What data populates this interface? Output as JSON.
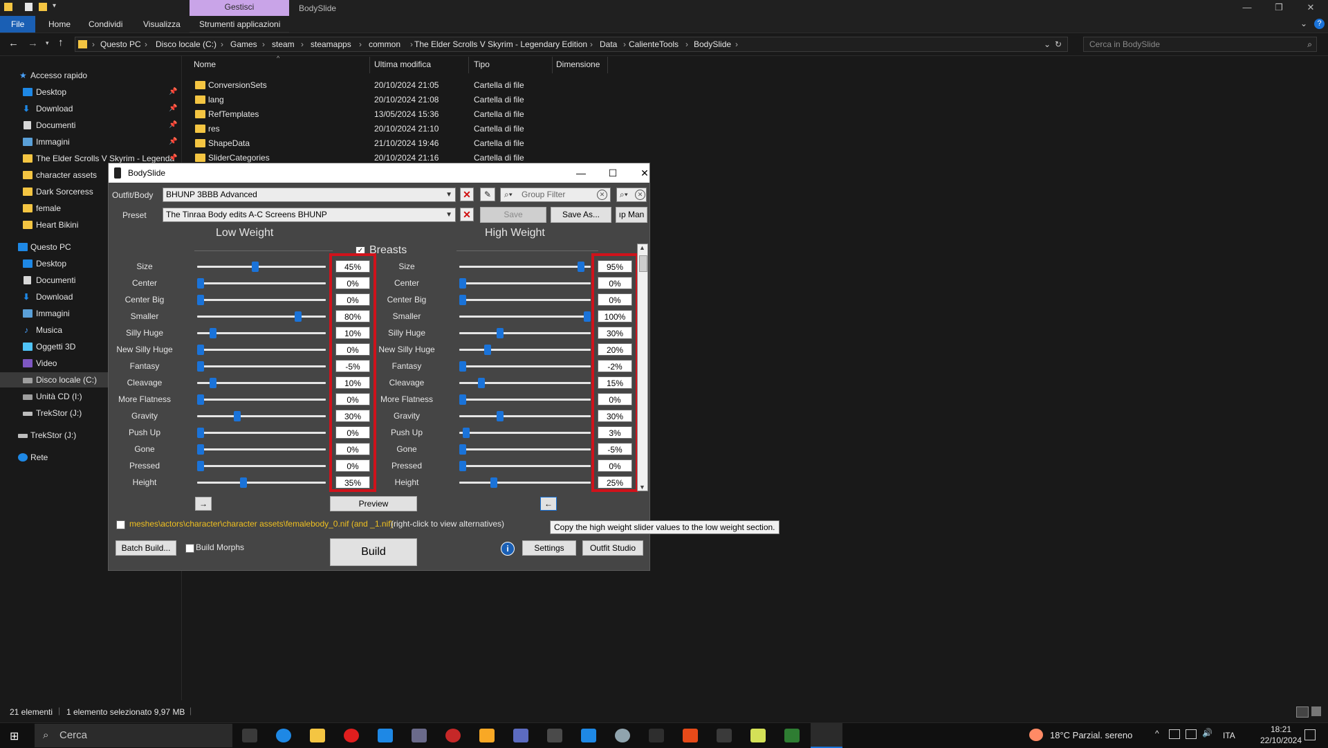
{
  "explorer": {
    "title_context_tab": "Gestisci",
    "title_window": "BodySlide",
    "ribbon_tabs": [
      "File",
      "Home",
      "Condividi",
      "Visualizza",
      "Strumenti applicazioni"
    ],
    "breadcrumb": [
      "Questo PC",
      "Disco locale (C:)",
      "Games",
      "steam",
      "steamapps",
      "common",
      "The Elder Scrolls V Skyrim - Legendary Edition",
      "Data",
      "CalienteTools",
      "BodySlide"
    ],
    "search_placeholder": "Cerca in BodySlide",
    "nav": {
      "quick_access": "Accesso rapido",
      "quick_items": [
        "Desktop",
        "Download",
        "Documenti",
        "Immagini",
        "The Elder Scrolls V Skyrim - Legenda",
        "character assets",
        "Dark Sorceress",
        "female",
        "Heart Bikini"
      ],
      "this_pc": "Questo PC",
      "pc_items": [
        "Desktop",
        "Documenti",
        "Download",
        "Immagini",
        "Musica",
        "Oggetti 3D",
        "Video",
        "Disco locale (C:)",
        "Unità CD (I:)",
        "TrekStor (J:)"
      ],
      "trekstor": "TrekStor (J:)",
      "network": "Rete"
    },
    "columns": [
      "Nome",
      "Ultima modifica",
      "Tipo",
      "Dimensione"
    ],
    "files": [
      {
        "name": "ConversionSets",
        "date": "20/10/2024 21:05",
        "type": "Cartella di file"
      },
      {
        "name": "lang",
        "date": "20/10/2024 21:08",
        "type": "Cartella di file"
      },
      {
        "name": "RefTemplates",
        "date": "13/05/2024 15:36",
        "type": "Cartella di file"
      },
      {
        "name": "res",
        "date": "20/10/2024 21:10",
        "type": "Cartella di file"
      },
      {
        "name": "ShapeData",
        "date": "21/10/2024 19:46",
        "type": "Cartella di file"
      },
      {
        "name": "SliderCategories",
        "date": "20/10/2024 21:16",
        "type": "Cartella di file"
      }
    ],
    "status": {
      "count": "21 elementi",
      "selected": "1 elemento selezionato  9,97 MB"
    }
  },
  "bodyslide": {
    "title": "BodySlide",
    "outfit_label": "Outfit/Body",
    "outfit_value": "BHUNP 3BBB Advanced",
    "group_filter_placeholder": "Group Filter",
    "preset_label": "Preset",
    "preset_value": "The Tinraa Body edits A-C Screens BHUNP",
    "save": "Save",
    "save_as": "Save As...",
    "group_manager": "ıp Man",
    "low_weight": "Low Weight",
    "high_weight": "High Weight",
    "category": "Breasts",
    "sliders": [
      {
        "name": "Size",
        "low": "45%",
        "high": "95%",
        "lowv": 45,
        "highv": 95
      },
      {
        "name": "Center",
        "low": "0%",
        "high": "0%",
        "lowv": 0,
        "highv": 0
      },
      {
        "name": "Center Big",
        "low": "0%",
        "high": "0%",
        "lowv": 0,
        "highv": 0
      },
      {
        "name": "Smaller",
        "low": "80%",
        "high": "100%",
        "lowv": 80,
        "highv": 100
      },
      {
        "name": "Silly Huge",
        "low": "10%",
        "high": "30%",
        "lowv": 10,
        "highv": 30
      },
      {
        "name": "New Silly Huge",
        "low": "0%",
        "high": "20%",
        "lowv": 0,
        "highv": 20
      },
      {
        "name": "Fantasy",
        "low": "-5%",
        "high": "-2%",
        "lowv": -5,
        "highv": -2
      },
      {
        "name": "Cleavage",
        "low": "10%",
        "high": "15%",
        "lowv": 10,
        "highv": 15
      },
      {
        "name": "More Flatness",
        "low": "0%",
        "high": "0%",
        "lowv": 0,
        "highv": 0
      },
      {
        "name": "Gravity",
        "low": "30%",
        "high": "30%",
        "lowv": 30,
        "highv": 30
      },
      {
        "name": "Push Up",
        "low": "0%",
        "high": "3%",
        "lowv": 0,
        "highv": 3
      },
      {
        "name": "Gone",
        "low": "0%",
        "high": "-5%",
        "lowv": 0,
        "highv": -5
      },
      {
        "name": "Pressed",
        "low": "0%",
        "high": "0%",
        "lowv": 0,
        "highv": 0
      },
      {
        "name": "Height",
        "low": "35%",
        "high": "25%",
        "lowv": 35,
        "highv": 25
      }
    ],
    "copy_right": "→",
    "copy_left": "←",
    "preview": "Preview",
    "path": "meshes\\actors\\character\\character assets\\femalebody_0.nif (and _1.nif)",
    "path_hint": "(right-click to view alternatives)",
    "tooltip": "Copy the high weight slider values to the low weight section.",
    "batch_build": "Batch Build...",
    "build_morphs": "Build Morphs",
    "build": "Build",
    "settings": "Settings",
    "outfit_studio": "Outfit Studio"
  },
  "taskbar": {
    "search": "Cerca",
    "weather": "18°C  Parzial. sereno",
    "lang": "ITA",
    "time": "18:21",
    "date": "22/10/2024"
  },
  "colors": {
    "accent": "#1a73d9",
    "highlight": "#d0121b",
    "folder": "#f4c542",
    "manage_tab": "#c9a4e8"
  }
}
